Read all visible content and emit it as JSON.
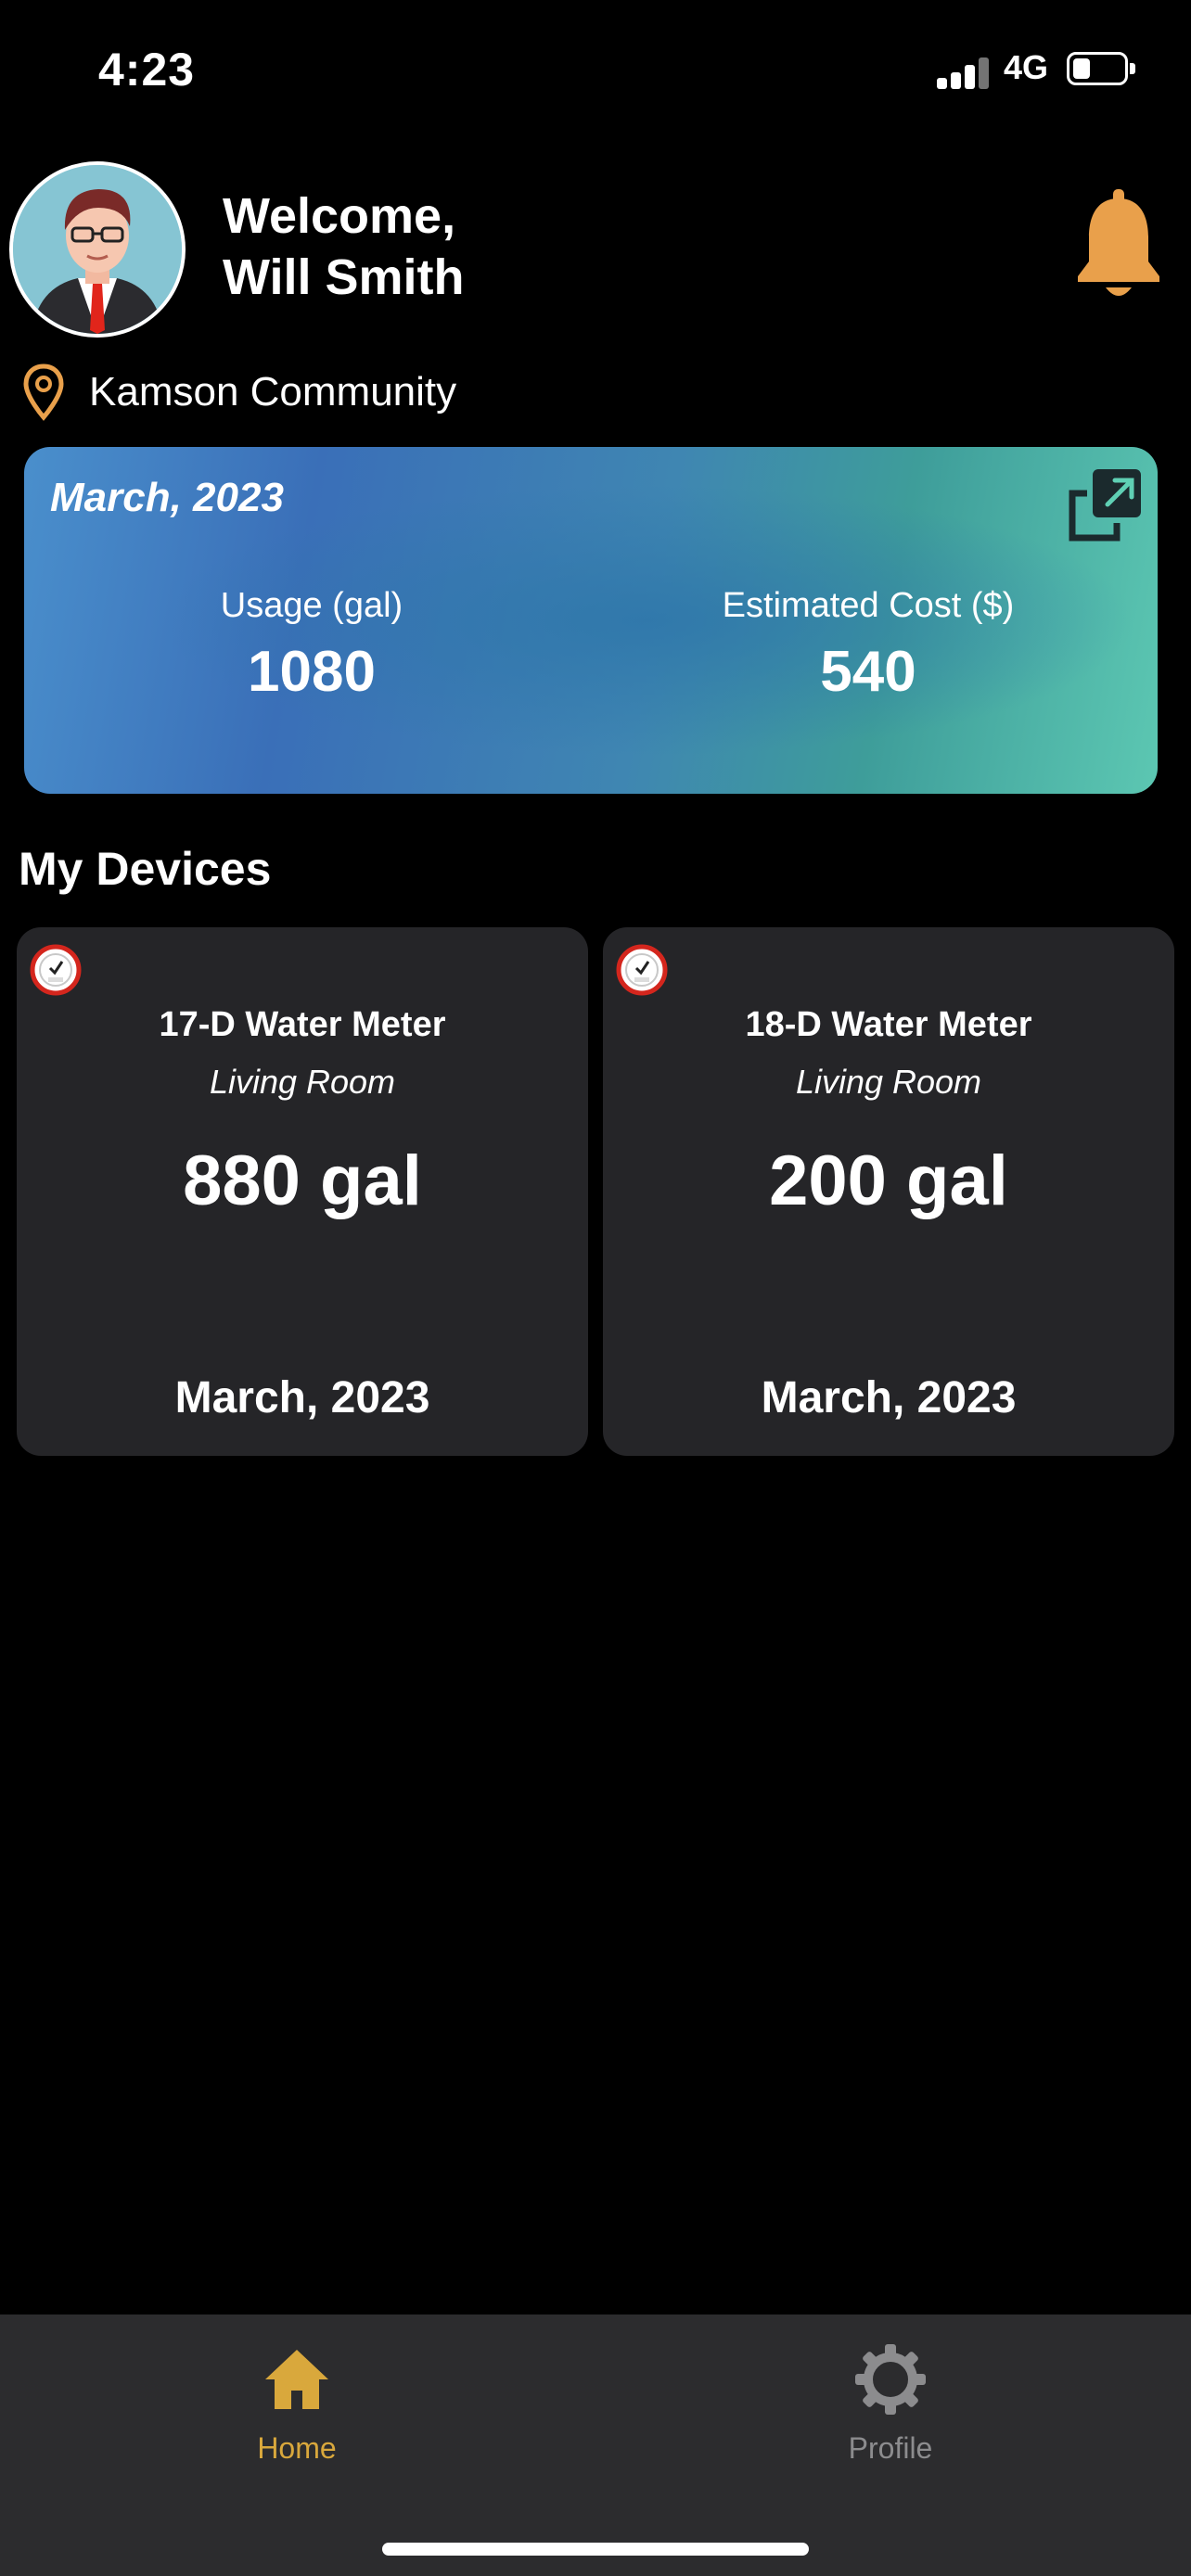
{
  "status_bar": {
    "time": "4:23",
    "network": "4G"
  },
  "header": {
    "welcome_line1": "Welcome,",
    "welcome_line2": "Will Smith",
    "avatar_icon": "user-avatar",
    "bell_icon": "bell-icon",
    "location": "Kamson Community",
    "location_icon": "map-pin-icon"
  },
  "summary": {
    "period": "March, 2023",
    "usage_label": "Usage (gal)",
    "usage_value": "1080",
    "cost_label": "Estimated Cost ($)",
    "cost_value": "540",
    "expand_icon": "expand-icon"
  },
  "devices_title": "My Devices",
  "devices": [
    {
      "name": "17-D Water Meter",
      "room": "Living Room",
      "usage": "880 gal",
      "date": "March, 2023"
    },
    {
      "name": "18-D Water Meter",
      "room": "Living Room",
      "usage": "200 gal",
      "date": "March, 2023"
    }
  ],
  "tabs": [
    {
      "label": "Home",
      "icon": "home-icon",
      "active": true
    },
    {
      "label": "Profile",
      "icon": "gear-icon",
      "active": false
    }
  ],
  "colors": {
    "accent": "#d9a83c",
    "bell": "#e9a04b",
    "card_bg": "#252528",
    "tab_bar_bg": "#2c2c2e"
  }
}
